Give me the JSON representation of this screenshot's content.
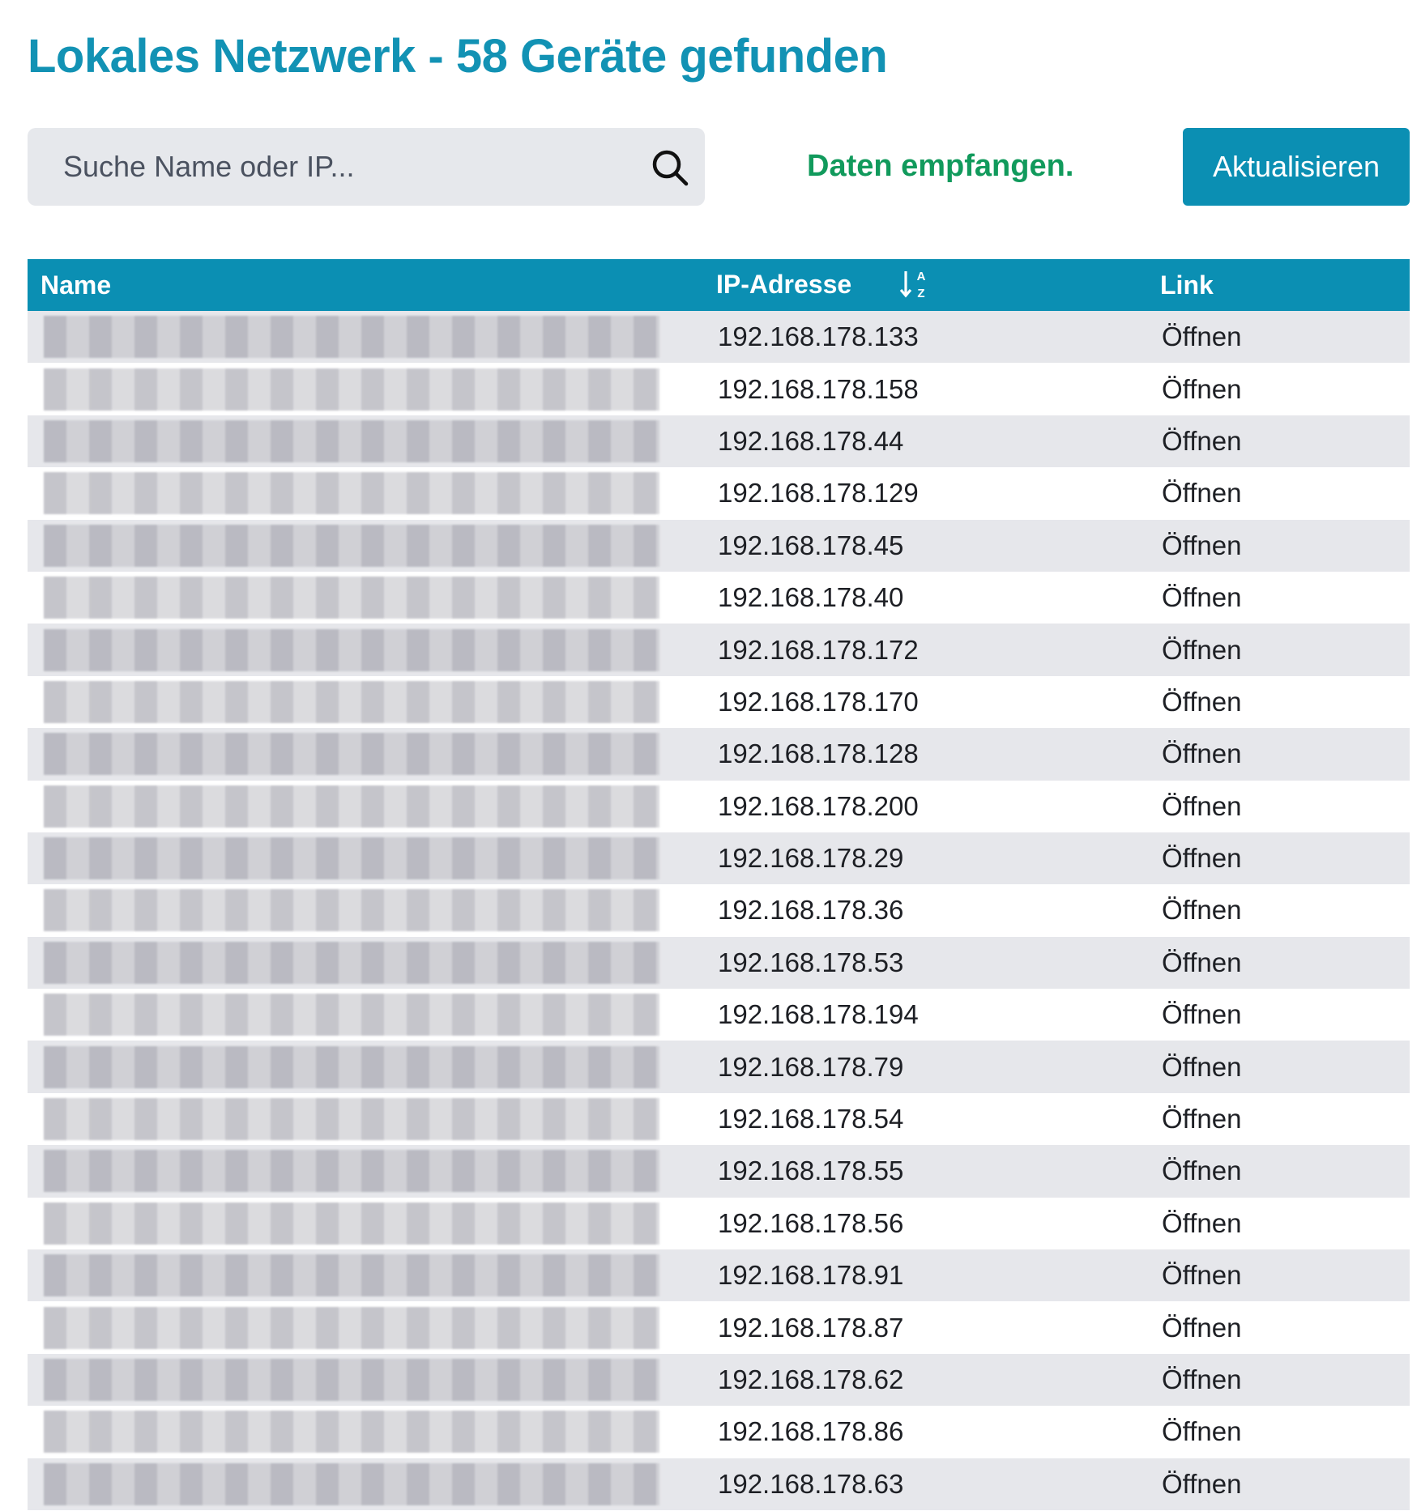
{
  "header": {
    "title": "Lokales Netzwerk - 58 Geräte gefunden"
  },
  "toolbar": {
    "search_placeholder": "Suche Name oder IP...",
    "status": "Daten empfangen.",
    "refresh_label": "Aktualisieren"
  },
  "colors": {
    "accent": "#0b8fb3",
    "status_green": "#119a5c",
    "row_stripe": "#e6e7eb"
  },
  "table": {
    "columns": {
      "name": "Name",
      "ip": "IP-Adresse",
      "link": "Link"
    },
    "sort_icon": "sort-alpha-down-icon",
    "rows": [
      {
        "name": "",
        "ip": "192.168.178.133",
        "link": "Öffnen"
      },
      {
        "name": "",
        "ip": "192.168.178.158",
        "link": "Öffnen"
      },
      {
        "name": "",
        "ip": "192.168.178.44",
        "link": "Öffnen"
      },
      {
        "name": "",
        "ip": "192.168.178.129",
        "link": "Öffnen"
      },
      {
        "name": "",
        "ip": "192.168.178.45",
        "link": "Öffnen"
      },
      {
        "name": "",
        "ip": "192.168.178.40",
        "link": "Öffnen"
      },
      {
        "name": "",
        "ip": "192.168.178.172",
        "link": "Öffnen"
      },
      {
        "name": "",
        "ip": "192.168.178.170",
        "link": "Öffnen"
      },
      {
        "name": "",
        "ip": "192.168.178.128",
        "link": "Öffnen"
      },
      {
        "name": "",
        "ip": "192.168.178.200",
        "link": "Öffnen"
      },
      {
        "name": "",
        "ip": "192.168.178.29",
        "link": "Öffnen"
      },
      {
        "name": "",
        "ip": "192.168.178.36",
        "link": "Öffnen"
      },
      {
        "name": "",
        "ip": "192.168.178.53",
        "link": "Öffnen"
      },
      {
        "name": "",
        "ip": "192.168.178.194",
        "link": "Öffnen"
      },
      {
        "name": "",
        "ip": "192.168.178.79",
        "link": "Öffnen"
      },
      {
        "name": "",
        "ip": "192.168.178.54",
        "link": "Öffnen"
      },
      {
        "name": "",
        "ip": "192.168.178.55",
        "link": "Öffnen"
      },
      {
        "name": "",
        "ip": "192.168.178.56",
        "link": "Öffnen"
      },
      {
        "name": "",
        "ip": "192.168.178.91",
        "link": "Öffnen"
      },
      {
        "name": "",
        "ip": "192.168.178.87",
        "link": "Öffnen"
      },
      {
        "name": "",
        "ip": "192.168.178.62",
        "link": "Öffnen"
      },
      {
        "name": "",
        "ip": "192.168.178.86",
        "link": "Öffnen"
      },
      {
        "name": "",
        "ip": "192.168.178.63",
        "link": "Öffnen"
      }
    ]
  }
}
